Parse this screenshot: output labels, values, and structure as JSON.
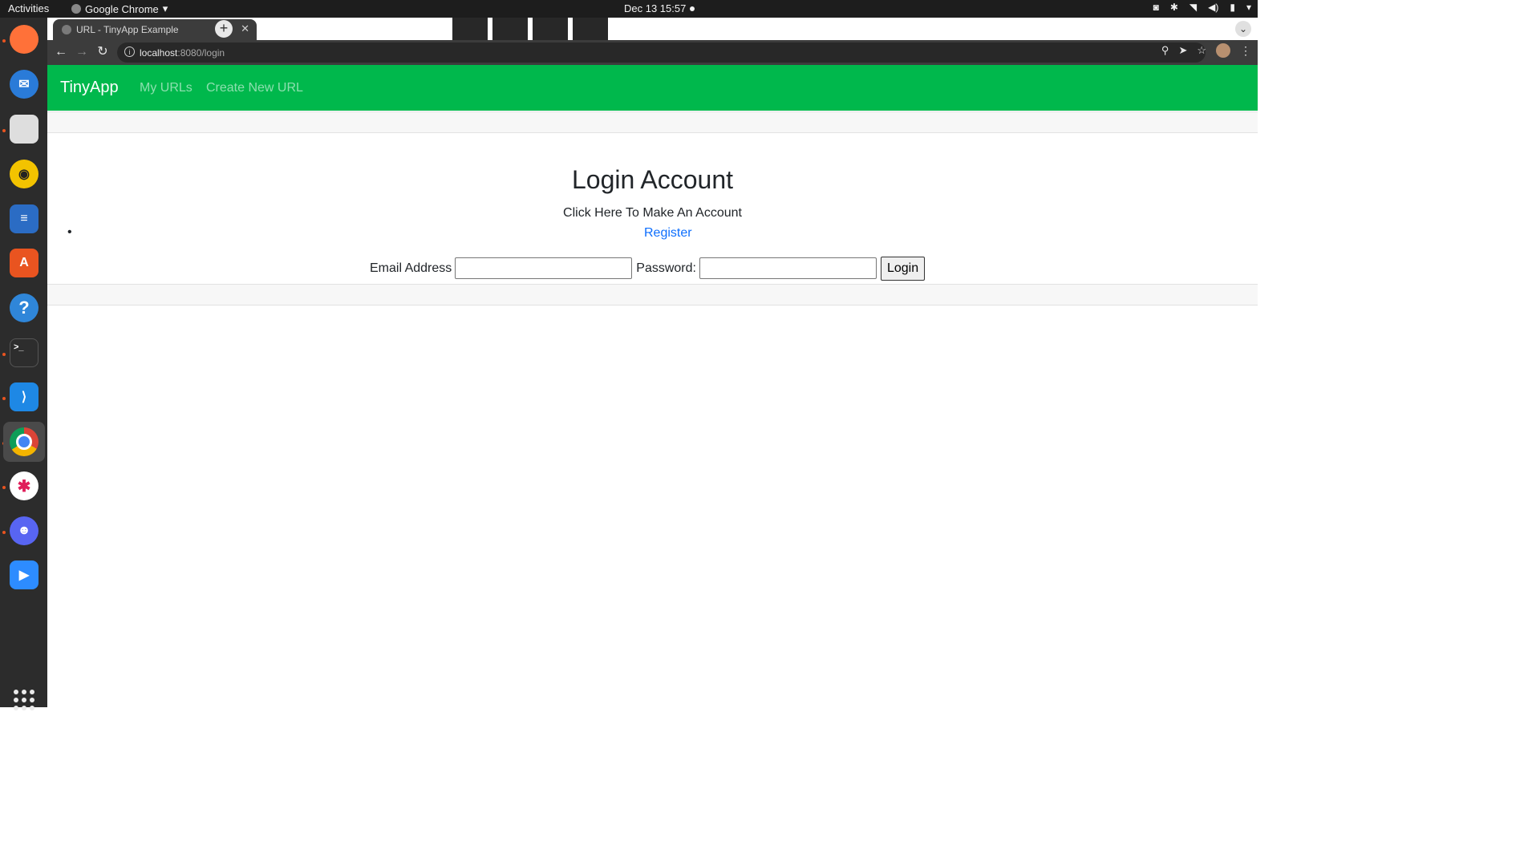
{
  "system_bar": {
    "activities": "Activities",
    "app_name": "Google Chrome",
    "clock": "Dec 13  15:57"
  },
  "dock": {
    "items": [
      {
        "name": "Firefox",
        "icon": "firefox-icon",
        "color": "#ff7139"
      },
      {
        "name": "Thunderbird",
        "icon": "thunderbird-icon",
        "color": "#2a7bd8"
      },
      {
        "name": "Files",
        "icon": "files-icon",
        "color": "#dedede"
      },
      {
        "name": "Rhythmbox",
        "icon": "rhythmbox-icon",
        "color": "#f3c300"
      },
      {
        "name": "LibreOffice Writer",
        "icon": "writer-icon",
        "color": "#2b6cc4"
      },
      {
        "name": "Ubuntu Software",
        "icon": "software-icon",
        "color": "#e95420"
      },
      {
        "name": "Help",
        "icon": "help-icon",
        "color": "#2f86d9"
      },
      {
        "name": "Terminal",
        "icon": "terminal-icon",
        "color": "#2d2d2d"
      },
      {
        "name": "VS Code",
        "icon": "vscode-icon",
        "color": "#1e88e5"
      },
      {
        "name": "Google Chrome",
        "icon": "chrome-icon",
        "color": "#ffffff"
      },
      {
        "name": "Slack",
        "icon": "slack-icon",
        "color": "#ffffff"
      },
      {
        "name": "Discord",
        "icon": "discord-icon",
        "color": "#5865f2"
      },
      {
        "name": "Zoom",
        "icon": "zoom-icon",
        "color": "#2d8cff"
      }
    ]
  },
  "browser": {
    "tab_title": "URL - TinyApp Example",
    "new_tab_label": "+",
    "url_host": "localhost",
    "url_rest": ":8080/login"
  },
  "app": {
    "brand": "TinyApp",
    "nav": {
      "my_urls": "My URLs",
      "create_new_url": "Create New URL"
    },
    "heading": "Login Account",
    "subheading": "Click Here To Make An Account",
    "bullet": "•",
    "register_link": "Register",
    "form": {
      "email_label": "Email Address",
      "email_value": "",
      "password_label": "Password:",
      "password_value": "",
      "login_button": "Login"
    },
    "colors": {
      "navbar": "#00b84c",
      "link": "#0d6efd"
    }
  }
}
